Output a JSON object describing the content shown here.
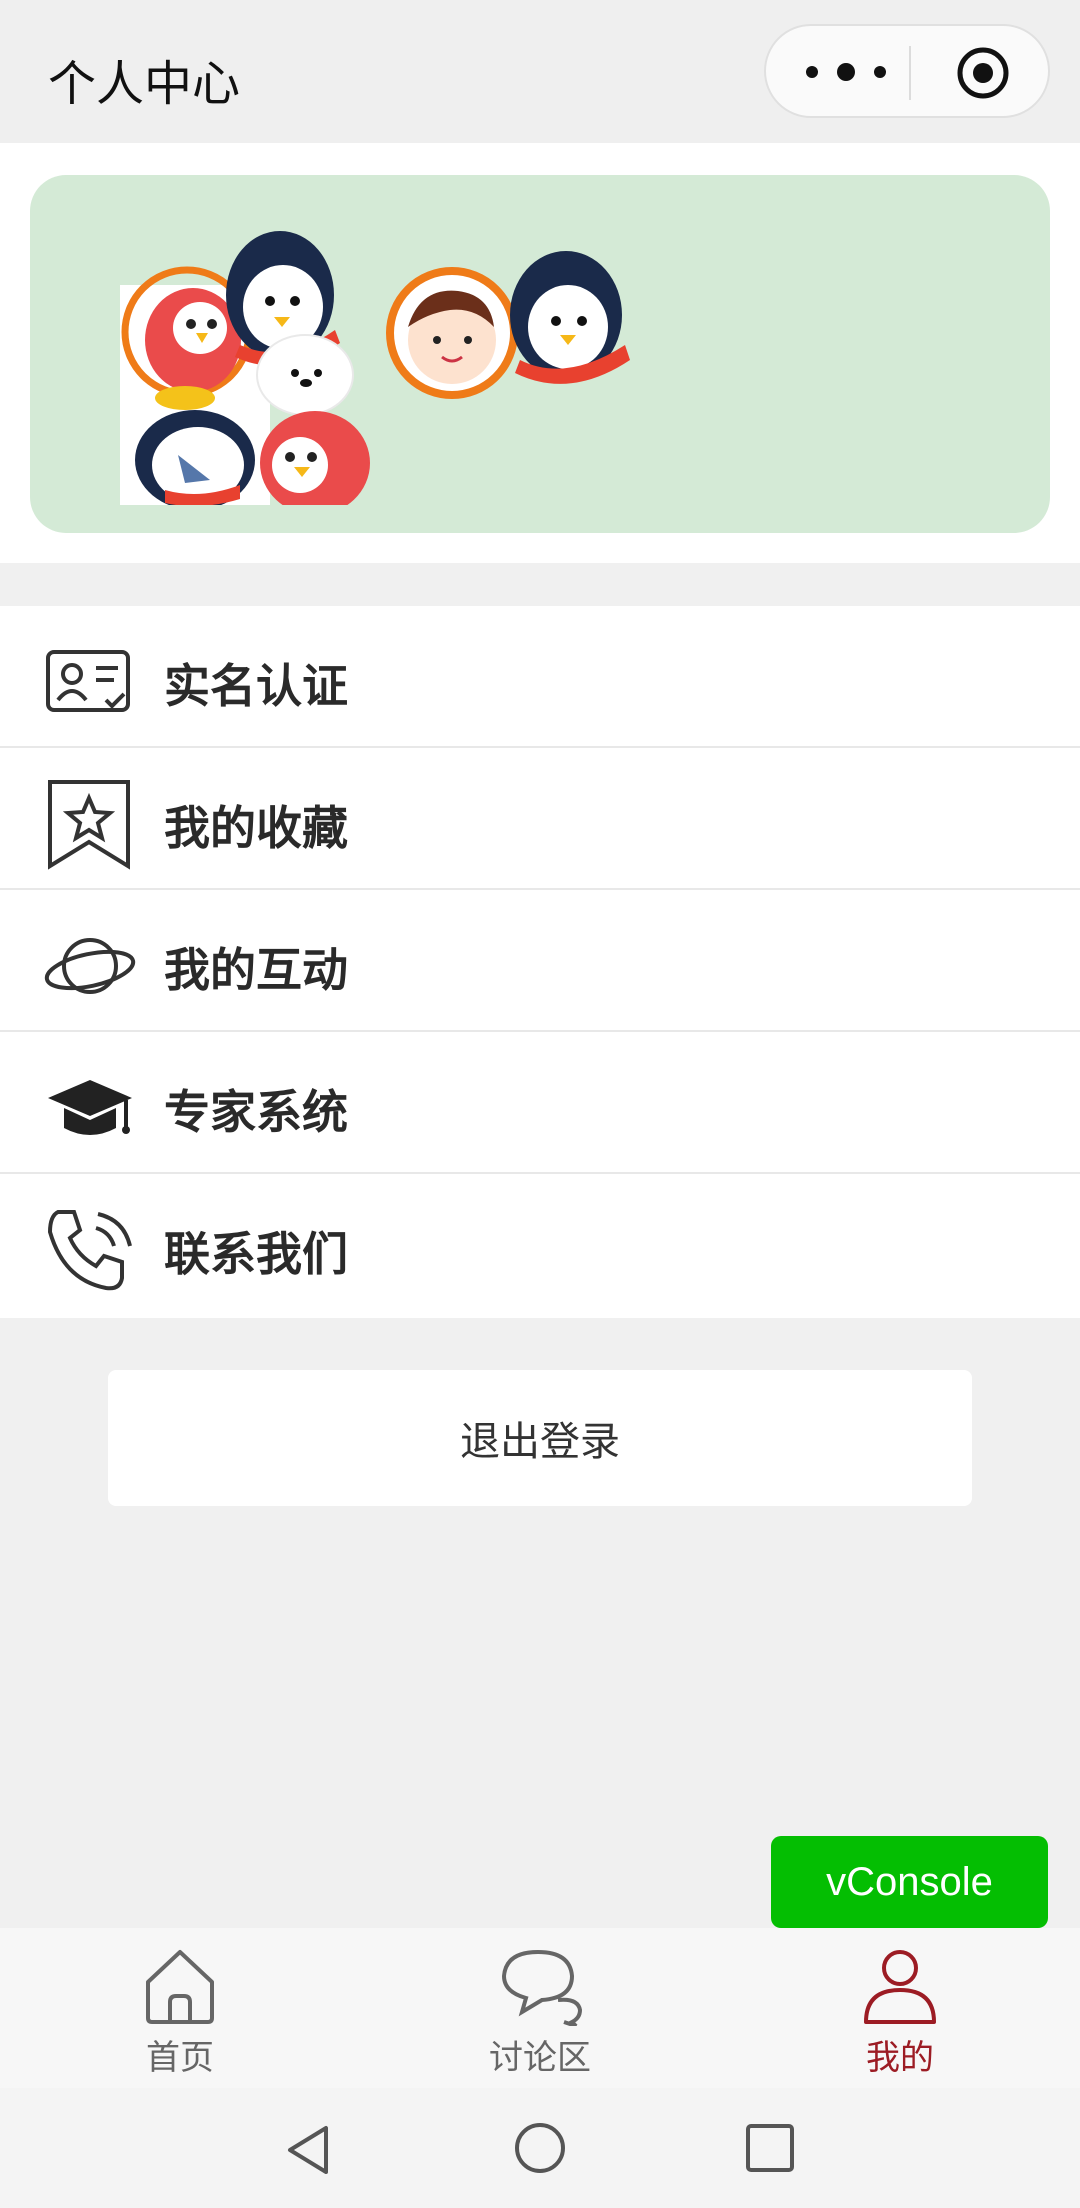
{
  "header": {
    "title": "个人中心"
  },
  "capsule": {
    "more_icon": "more-dots-icon",
    "close_icon": "target-icon"
  },
  "menu": {
    "items": [
      {
        "label": "实名认证",
        "icon": "id-card-icon"
      },
      {
        "label": "我的收藏",
        "icon": "bookmark-star-icon"
      },
      {
        "label": "我的互动",
        "icon": "planet-icon"
      },
      {
        "label": "专家系统",
        "icon": "graduation-cap-icon"
      },
      {
        "label": "联系我们",
        "icon": "phone-icon"
      }
    ]
  },
  "logout": {
    "label": "退出登录"
  },
  "vconsole": {
    "label": "vConsole"
  },
  "tabbar": {
    "tabs": [
      {
        "label": "首页",
        "icon": "home-icon",
        "active": false
      },
      {
        "label": "讨论区",
        "icon": "chat-bubbles-icon",
        "active": false
      },
      {
        "label": "我的",
        "icon": "user-icon",
        "active": true
      }
    ]
  },
  "colors": {
    "banner_bg": "#d4ead6",
    "active_tab": "#9c1c24",
    "vconsole_bg": "#04be02"
  }
}
